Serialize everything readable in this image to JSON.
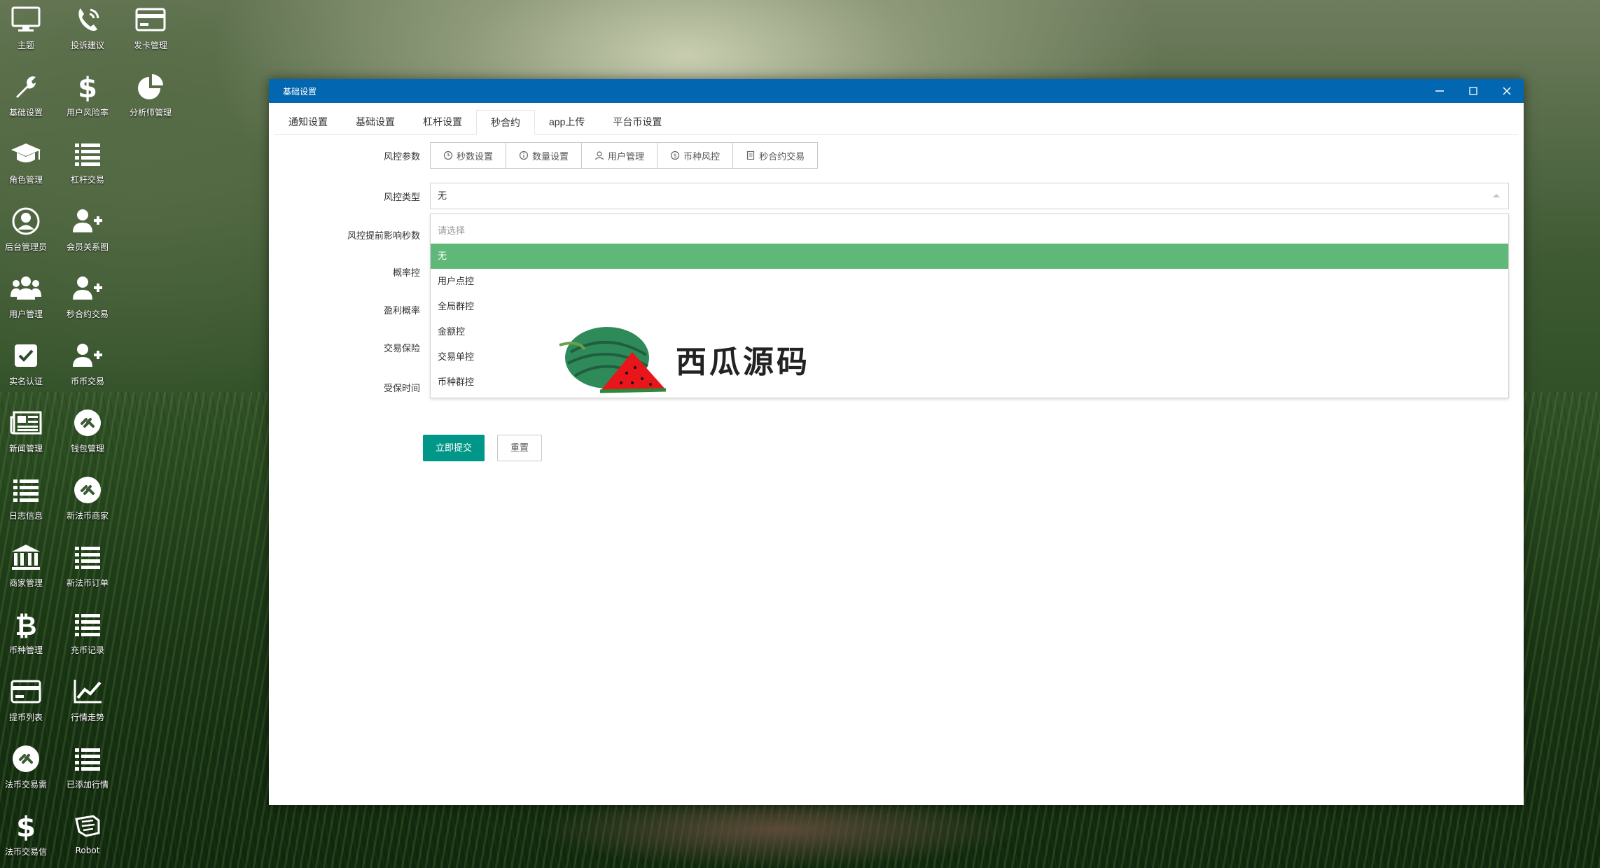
{
  "desktop": {
    "icons": [
      {
        "label": "主题",
        "icon": "monitor-icon"
      },
      {
        "label": "投诉建议",
        "icon": "phone-icon"
      },
      {
        "label": "发卡管理",
        "icon": "credit-card-icon"
      },
      {
        "label": "基础设置",
        "icon": "wrench-icon"
      },
      {
        "label": "用户风险率",
        "icon": "dollar-icon"
      },
      {
        "label": "分析师管理",
        "icon": "pie-chart-icon"
      },
      {
        "label": "角色管理",
        "icon": "graduation-cap-icon"
      },
      {
        "label": "杠杆交易",
        "icon": "list-icon"
      },
      {
        "label": "后台管理员",
        "icon": "user-circle-icon"
      },
      {
        "label": "会员关系图",
        "icon": "user-plus-icon"
      },
      {
        "label": "用户管理",
        "icon": "users-icon"
      },
      {
        "label": "秒合约交易",
        "icon": "user-plus-icon"
      },
      {
        "label": "实名认证",
        "icon": "check-square-icon"
      },
      {
        "label": "币币交易",
        "icon": "user-plus-icon"
      },
      {
        "label": "新闻管理",
        "icon": "newspaper-icon"
      },
      {
        "label": "钱包管理",
        "icon": "link-circle-icon"
      },
      {
        "label": "日志信息",
        "icon": "list-icon"
      },
      {
        "label": "新法币商家",
        "icon": "link-circle-icon"
      },
      {
        "label": "商家管理",
        "icon": "bank-icon"
      },
      {
        "label": "新法币订单",
        "icon": "list-icon"
      },
      {
        "label": "币种管理",
        "icon": "bitcoin-icon"
      },
      {
        "label": "充币记录",
        "icon": "list-icon"
      },
      {
        "label": "提币列表",
        "icon": "credit-card-icon"
      },
      {
        "label": "行情走势",
        "icon": "line-chart-icon"
      },
      {
        "label": "法币交易需",
        "icon": "link-circle-icon"
      },
      {
        "label": "已添加行情",
        "icon": "list-icon"
      },
      {
        "label": "法币交易信",
        "icon": "dollar-icon"
      },
      {
        "label": "Robot",
        "icon": "robot-hand-icon"
      }
    ]
  },
  "window": {
    "title": "基础设置",
    "tabs": [
      "通知设置",
      "基础设置",
      "杠杆设置",
      "秒合约",
      "app上传",
      "平台币设置"
    ],
    "active_tab": "秒合约"
  },
  "form": {
    "risk_params_label": "风控参数",
    "risk_params_buttons": [
      {
        "label": "秒数设置",
        "icon": "clock-icon"
      },
      {
        "label": "数量设置",
        "icon": "info-icon"
      },
      {
        "label": "用户管理",
        "icon": "user-icon"
      },
      {
        "label": "币种风控",
        "icon": "coin-icon"
      },
      {
        "label": "秒合约交易",
        "icon": "document-icon"
      }
    ],
    "risk_type_label": "风控类型",
    "risk_type_value": "无",
    "advance_seconds_label": "风控提前影响秒数",
    "probability_label": "概率控",
    "profit_prob_label": "盈利概率",
    "insurance_label": "交易保险",
    "insured_time_label": "受保时间",
    "dropdown_options": [
      "请选择",
      "无",
      "用户点控",
      "全局群控",
      "金额控",
      "交易单控",
      "币种群控"
    ],
    "submit_label": "立即提交",
    "reset_label": "重置"
  },
  "watermark": {
    "text": "西瓜源码"
  },
  "colors": {
    "titlebar": "#0266b0",
    "primary": "#009688",
    "selected": "#5fb878"
  }
}
